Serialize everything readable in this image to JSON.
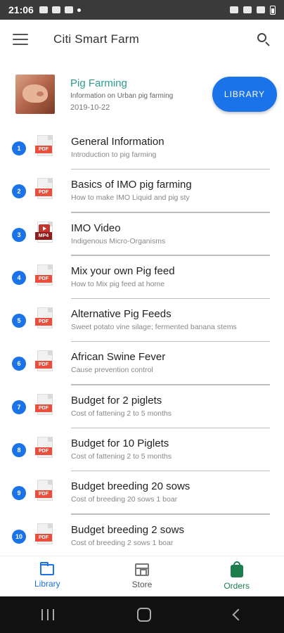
{
  "status_bar": {
    "time": "21:06"
  },
  "app_bar": {
    "title": "Citi Smart Farm",
    "menu_icon": "menu-icon",
    "search_icon": "search-icon"
  },
  "header": {
    "title": "Pig Farming",
    "subtitle": "Information on Urban pig farming",
    "date": "2019-10-22",
    "button_label": "LIBRARY"
  },
  "items": [
    {
      "num": "1",
      "type": "PDF",
      "title": "General Information",
      "subtitle": "Introduction to pig farming"
    },
    {
      "num": "2",
      "type": "PDF",
      "title": "Basics of IMO pig farming",
      "subtitle": "How to make IMO Liquid and pig sty"
    },
    {
      "num": "3",
      "type": "MP4",
      "title": "IMO Video",
      "subtitle": "Indigenous Micro-Organisms"
    },
    {
      "num": "4",
      "type": "PDF",
      "title": "Mix your own Pig feed",
      "subtitle": "How to Mix pig feed at home"
    },
    {
      "num": "5",
      "type": "PDF",
      "title": "Alternative Pig Feeds",
      "subtitle": "Sweet potato vine silage; fermented banana stems"
    },
    {
      "num": "6",
      "type": "PDF",
      "title": "African Swine Fever",
      "subtitle": "Cause prevention control"
    },
    {
      "num": "7",
      "type": "PDF",
      "title": "Budget for 2 piglets",
      "subtitle": "Cost of fattening 2 to 5 months"
    },
    {
      "num": "8",
      "type": "PDF",
      "title": "Budget for 10 Piglets",
      "subtitle": "Cost of fattening 2 to 5 months"
    },
    {
      "num": "9",
      "type": "PDF",
      "title": "Budget breeding 20 sows",
      "subtitle": "Cost of breeding 20 sows 1 boar"
    },
    {
      "num": "10",
      "type": "PDF",
      "title": "Budget breeding 2 sows",
      "subtitle": "Cost of breeding 2 sows 1 boar"
    }
  ],
  "bottom_nav": {
    "library": "Library",
    "store": "Store",
    "orders": "Orders"
  },
  "colors": {
    "accent": "#1a73e8",
    "title_teal": "#2a9d8f",
    "orders_green": "#1e7d4e",
    "pdf_red": "#e94f3d"
  }
}
